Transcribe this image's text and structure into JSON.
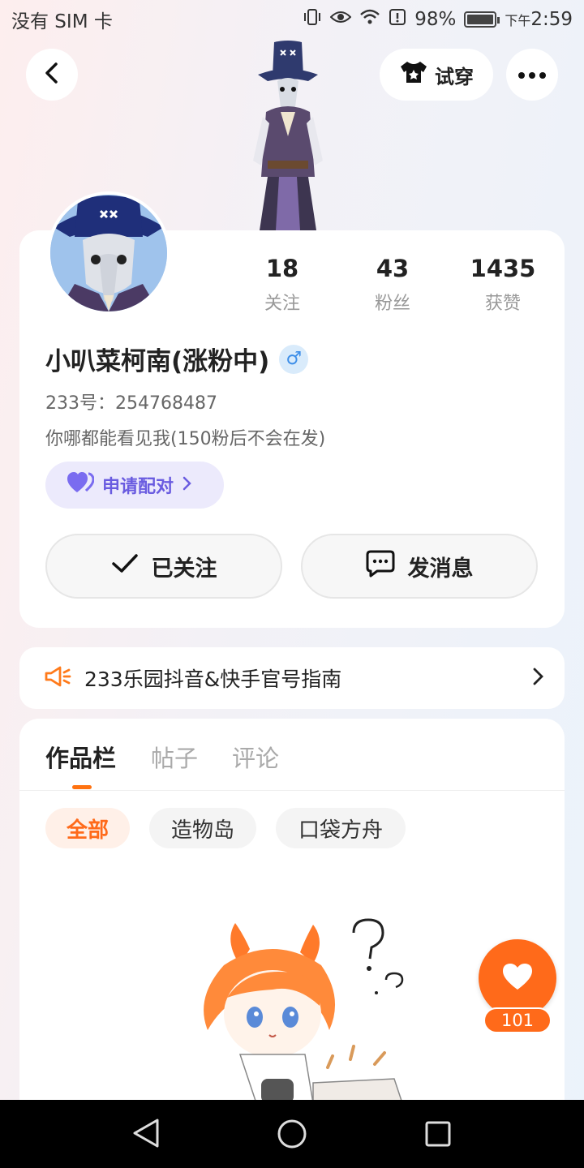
{
  "status_bar": {
    "carrier": "没有 SIM 卡",
    "battery": "98%",
    "battery_level": 0.98,
    "time_period": "下午",
    "time": "2:59"
  },
  "header": {
    "tryon_label": "试穿"
  },
  "profile": {
    "stats": [
      {
        "value": "18",
        "label": "关注"
      },
      {
        "value": "43",
        "label": "粉丝"
      },
      {
        "value": "1435",
        "label": "获赞"
      }
    ],
    "nickname": "小叭菜柯南(涨粉中)",
    "gender_symbol": "♂",
    "uid": "233号：254768487",
    "bio": "你哪都能看见我(150粉后不会在发)",
    "pair_label": "申请配对",
    "followed_label": "已关注",
    "message_label": "发消息"
  },
  "notice": {
    "text": "233乐园抖音&快手官号指南"
  },
  "tabs": [
    "作品栏",
    "帖子",
    "评论"
  ],
  "chips": [
    "全部",
    "造物岛",
    "口袋方舟"
  ],
  "like": {
    "count": "101"
  },
  "colors": {
    "accent": "#ff6a1a",
    "pair": "#6a5ce0",
    "gender": "#3d8ee8"
  }
}
